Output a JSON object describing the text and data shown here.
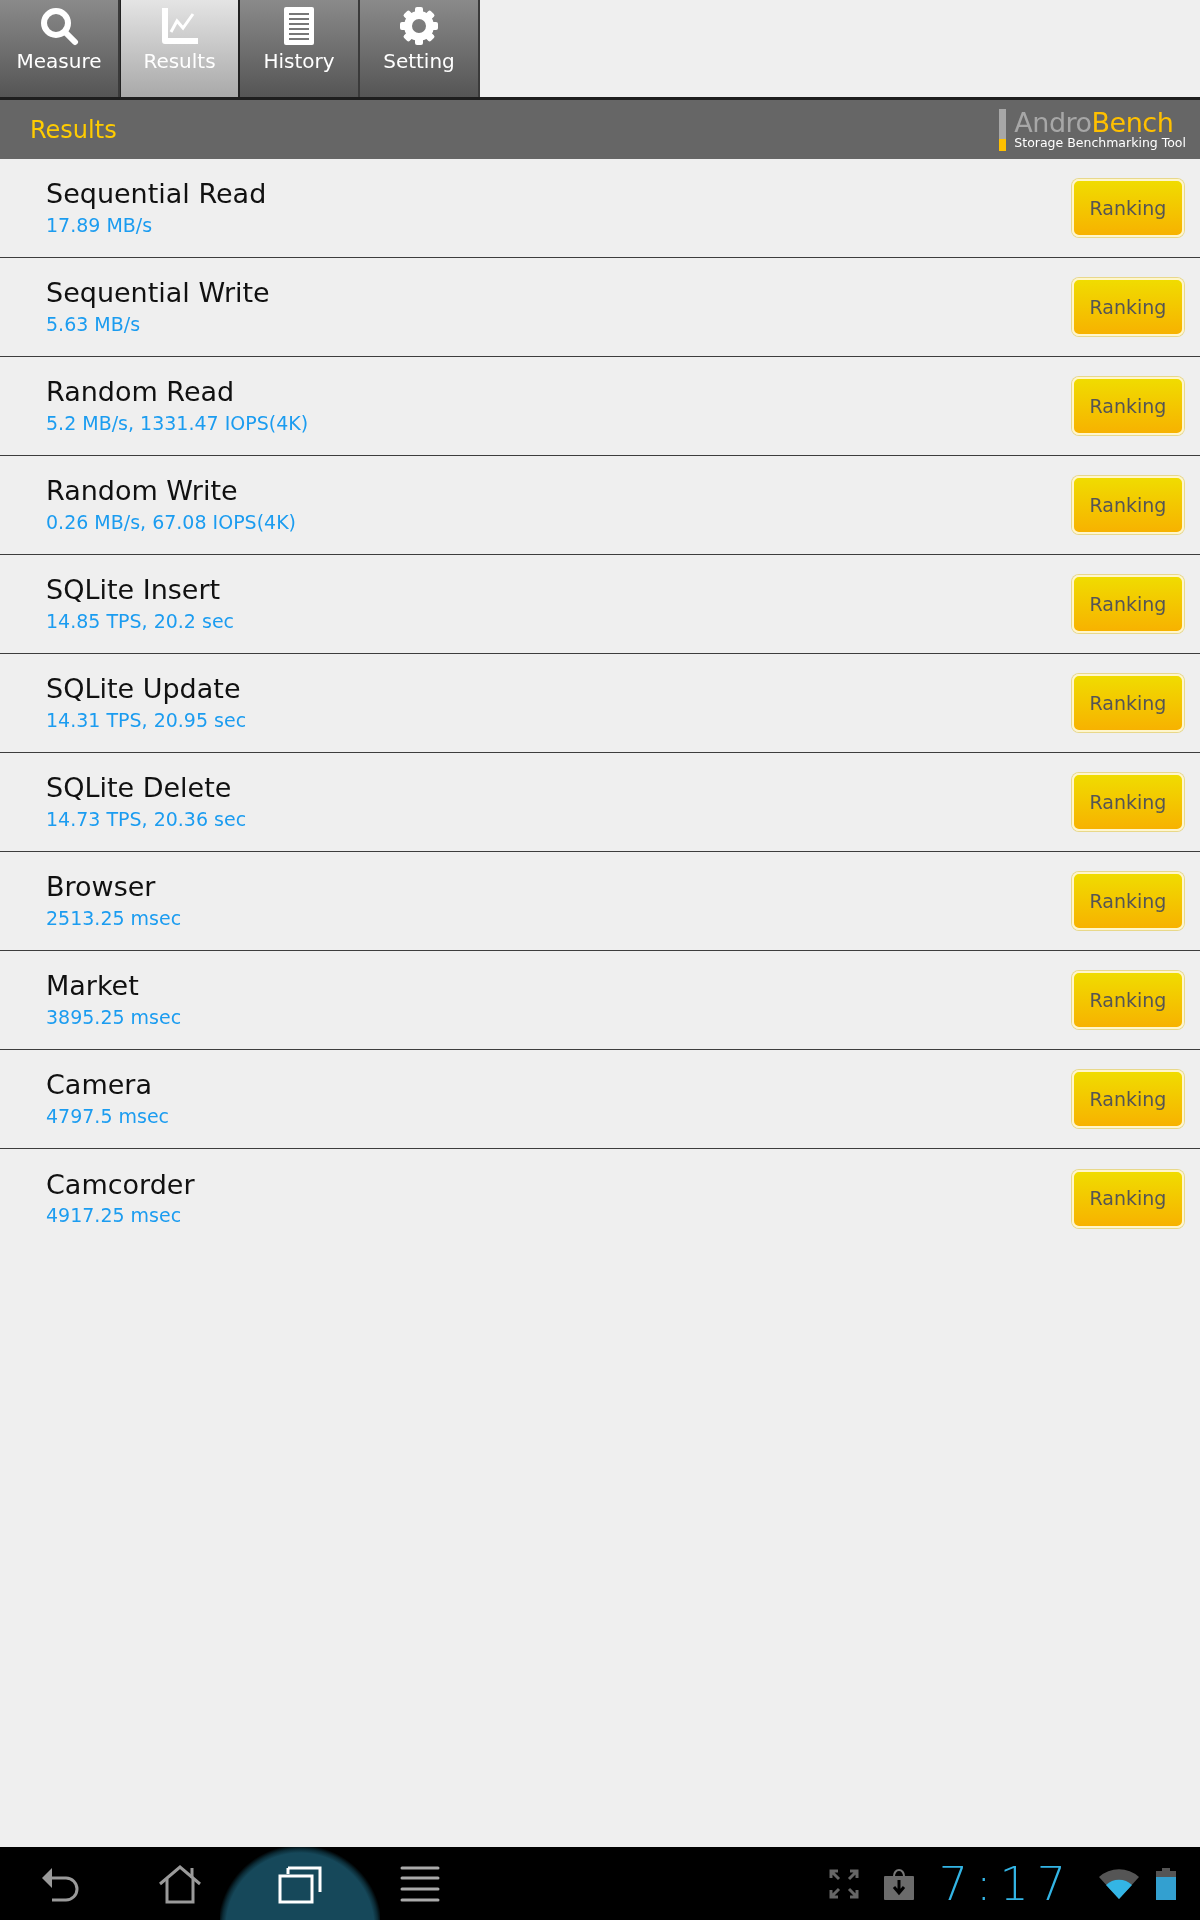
{
  "tabs": [
    {
      "label": "Measure",
      "selected": false
    },
    {
      "label": "Results",
      "selected": true
    },
    {
      "label": "History",
      "selected": false
    },
    {
      "label": "Setting",
      "selected": false
    }
  ],
  "header": {
    "title": "Results",
    "wordmark": [
      {
        "text": "Andro",
        "kind": "plain"
      },
      {
        "text": "Bench",
        "kind": "accent"
      }
    ],
    "tagline": "Storage Benchmarking Tool"
  },
  "results": [
    {
      "name": "Sequential Read",
      "value": "17.89 MB/s",
      "action": "Ranking"
    },
    {
      "name": "Sequential Write",
      "value": "5.63 MB/s",
      "action": "Ranking"
    },
    {
      "name": "Random Read",
      "value": "5.2 MB/s, 1331.47 IOPS(4K)",
      "action": "Ranking"
    },
    {
      "name": "Random Write",
      "value": "0.26 MB/s, 67.08 IOPS(4K)",
      "action": "Ranking"
    },
    {
      "name": "SQLite Insert",
      "value": "14.85 TPS, 20.2 sec",
      "action": "Ranking"
    },
    {
      "name": "SQLite Update",
      "value": "14.31 TPS, 20.95 sec",
      "action": "Ranking"
    },
    {
      "name": "SQLite Delete",
      "value": "14.73 TPS, 20.36 sec",
      "action": "Ranking"
    },
    {
      "name": "Browser",
      "value": "2513.25 msec",
      "action": "Ranking"
    },
    {
      "name": "Market",
      "value": "3895.25 msec",
      "action": "Ranking"
    },
    {
      "name": "Camera",
      "value": "4797.5 msec",
      "action": "Ranking"
    },
    {
      "name": "Camcorder",
      "value": "4917.25 msec",
      "action": "Ranking"
    }
  ],
  "system_bar": {
    "nav_buttons": [
      {
        "highlighted": false
      },
      {
        "highlighted": false
      },
      {
        "highlighted": true
      },
      {
        "highlighted": false
      }
    ],
    "clock": "7:17"
  }
}
